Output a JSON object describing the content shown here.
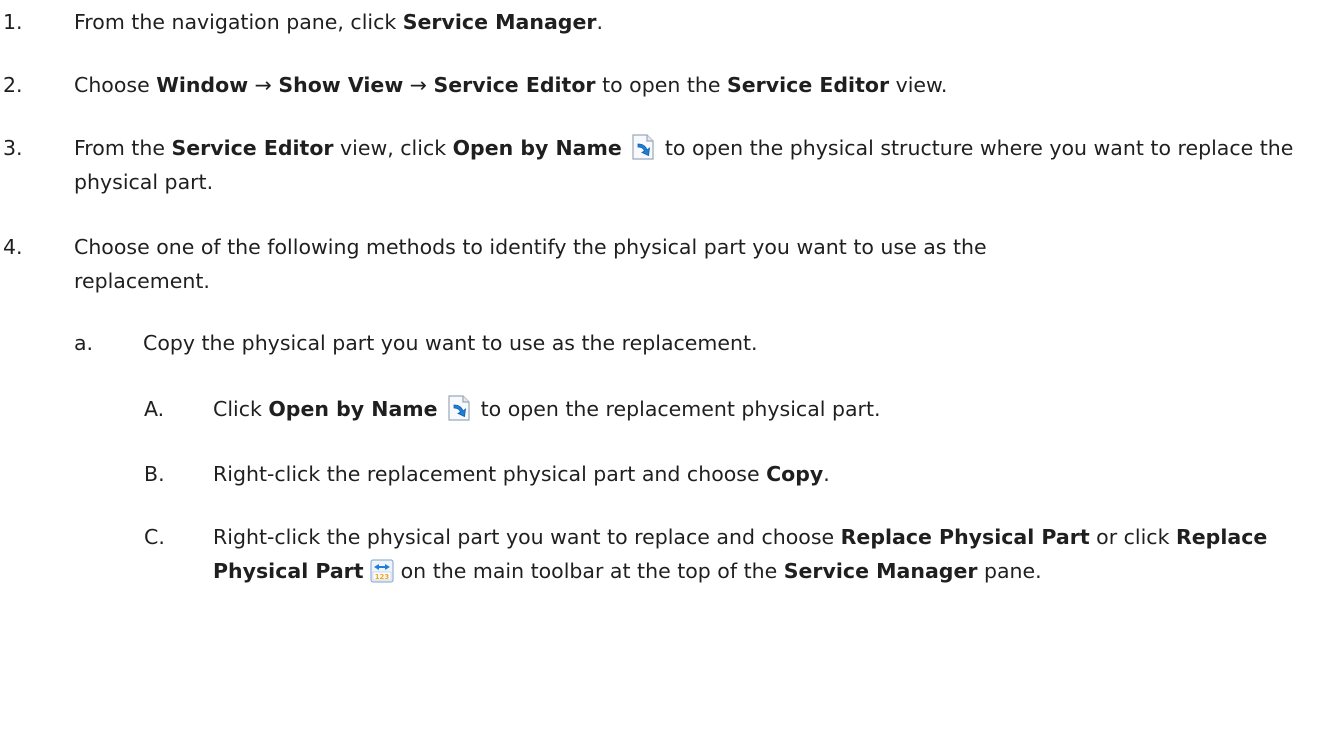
{
  "steps": [
    {
      "number": "1.",
      "parts": [
        "From the navigation pane, click ",
        "Service Manager",
        "."
      ]
    },
    {
      "number": "2.",
      "parts": [
        "Choose ",
        "Window",
        " → ",
        "Show View",
        " → ",
        "Service Editor",
        " to open the ",
        "Service Editor",
        " view."
      ]
    },
    {
      "number": "3.",
      "parts": [
        "From the ",
        "Service Editor",
        " view, click ",
        "Open by Name",
        " to open the physical structure where you want to replace the physical part."
      ]
    },
    {
      "number": "4.",
      "parts": [
        "Choose one of the following methods to identify the physical part you want to use as the replacement."
      ]
    }
  ],
  "substeps": [
    {
      "letter": "a.",
      "text": "Copy the physical part you want to use as the replacement."
    }
  ],
  "subsubsteps": [
    {
      "letter": "A.",
      "parts": [
        "Click ",
        "Open by Name",
        " to open the replacement physical part."
      ]
    },
    {
      "letter": "B.",
      "parts": [
        "Right-click the replacement physical part and choose ",
        "Copy",
        "."
      ]
    },
    {
      "letter": "C.",
      "parts": [
        "Right-click the physical part you want to replace and choose ",
        "Replace Physical Part",
        " or click ",
        "Replace Physical Part",
        " on the main toolbar at the top of the ",
        "Service Manager",
        " pane."
      ]
    }
  ],
  "icons": {
    "open_by_name": "open-by-name-icon",
    "replace_physical_part": "replace-physical-part-icon"
  },
  "colors": {
    "text": "#1f1f1f",
    "icon_blue": "#1e7fd8",
    "icon_orange": "#f2a41f"
  }
}
